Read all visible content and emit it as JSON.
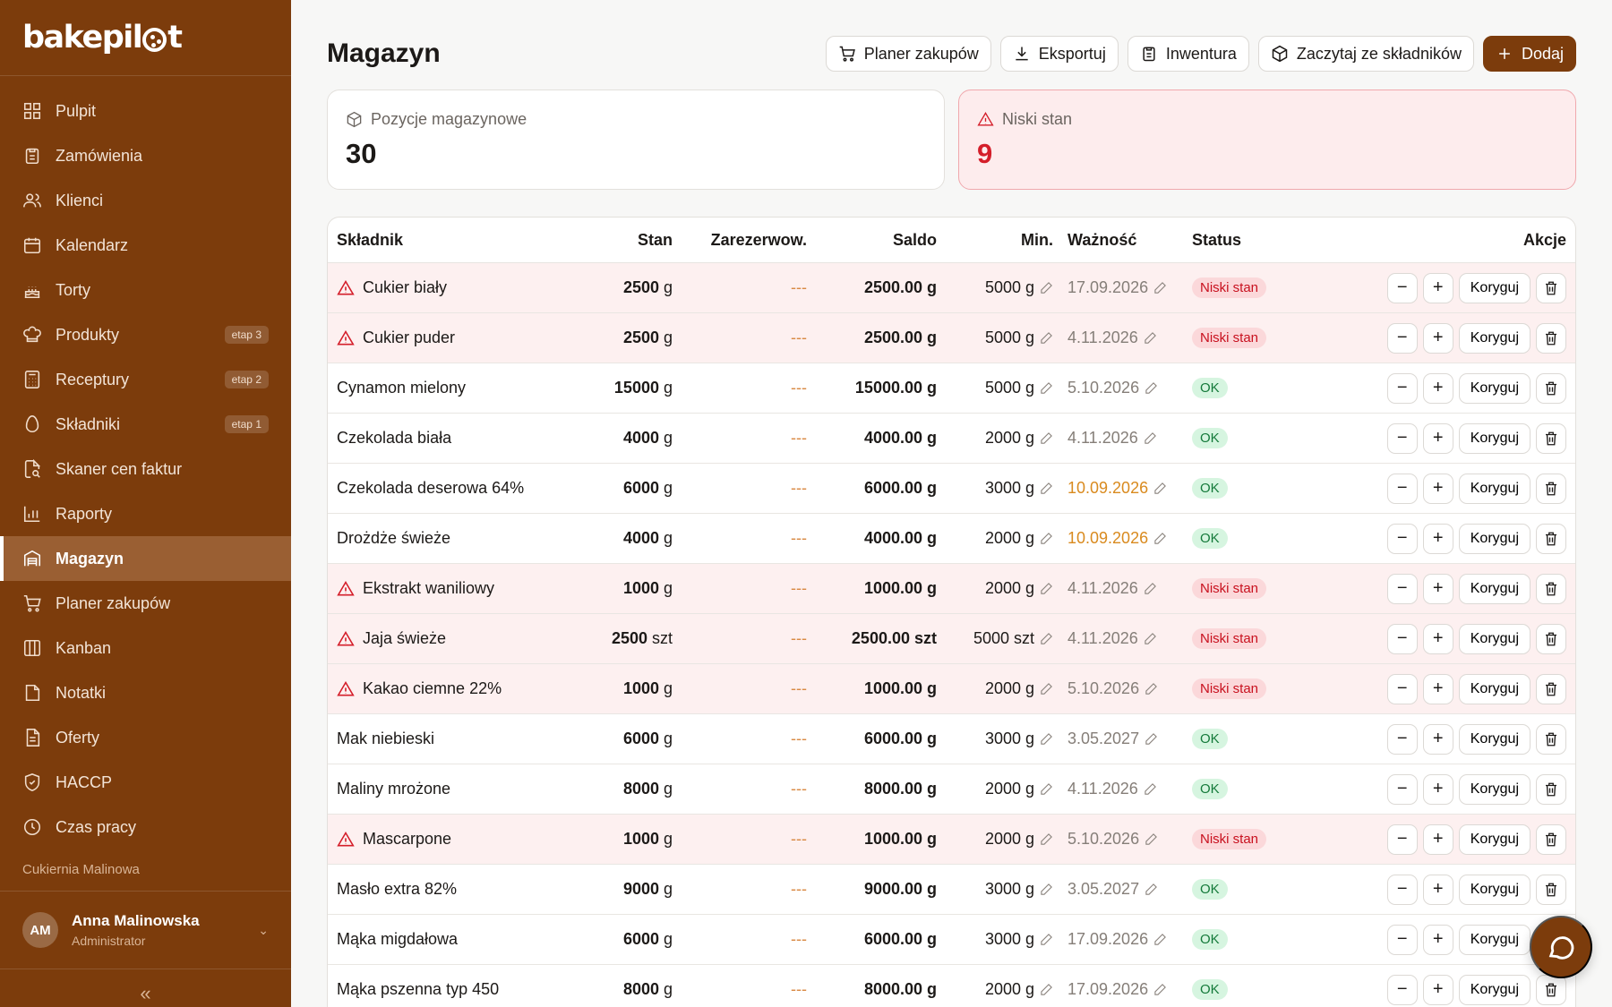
{
  "app": {
    "logo_text_a": "bakepil",
    "logo_text_b": "t"
  },
  "sidebar": {
    "items": [
      {
        "label": "Pulpit",
        "icon": "dashboard-icon",
        "badge": ""
      },
      {
        "label": "Zamówienia",
        "icon": "clipboard-icon",
        "badge": ""
      },
      {
        "label": "Klienci",
        "icon": "users-icon",
        "badge": ""
      },
      {
        "label": "Kalendarz",
        "icon": "calendar-icon",
        "badge": ""
      },
      {
        "label": "Torty",
        "icon": "cake-icon",
        "badge": ""
      },
      {
        "label": "Produkty",
        "icon": "chef-hat-icon",
        "badge": "etap 3"
      },
      {
        "label": "Receptury",
        "icon": "calculator-icon",
        "badge": "etap 2"
      },
      {
        "label": "Składniki",
        "icon": "egg-icon",
        "badge": "etap 1"
      },
      {
        "label": "Skaner cen faktur",
        "icon": "file-scan-icon",
        "badge": ""
      },
      {
        "label": "Raporty",
        "icon": "bar-chart-icon",
        "badge": ""
      },
      {
        "label": "Magazyn",
        "icon": "warehouse-icon",
        "badge": ""
      },
      {
        "label": "Planer zakupów",
        "icon": "cart-icon",
        "badge": ""
      },
      {
        "label": "Kanban",
        "icon": "kanban-icon",
        "badge": ""
      },
      {
        "label": "Notatki",
        "icon": "note-icon",
        "badge": ""
      },
      {
        "label": "Oferty",
        "icon": "document-icon",
        "badge": ""
      },
      {
        "label": "HACCP",
        "icon": "shield-icon",
        "badge": ""
      },
      {
        "label": "Czas pracy",
        "icon": "clock-icon",
        "badge": ""
      }
    ],
    "active_index": 10,
    "org_name": "Cukiernia Malinowa",
    "user": {
      "initials": "AM",
      "name": "Anna Malinowska",
      "role": "Administrator"
    },
    "collapse_label": "«"
  },
  "header": {
    "title": "Magazyn",
    "buttons": {
      "planner": "Planer zakupów",
      "export": "Eksportuj",
      "inventory": "Inwentura",
      "read_ingredients": "Zaczytaj ze składników",
      "add": "Dodaj"
    }
  },
  "cards": {
    "positions": {
      "label": "Pozycje magazynowe",
      "value": "30"
    },
    "low_stock": {
      "label": "Niski stan",
      "value": "9"
    }
  },
  "table": {
    "headers": {
      "name": "Składnik",
      "stan": "Stan",
      "reserved": "Zarezerwow.",
      "saldo": "Saldo",
      "min": "Min.",
      "expiry": "Ważność",
      "status": "Status",
      "actions": "Akcje"
    },
    "adjust_label": "Koryguj",
    "rows": [
      {
        "name": "Cukier biały",
        "low": true,
        "stan_val": "2500",
        "unit": "g",
        "reserved": "---",
        "saldo": "2500.00 g",
        "min": "5000 g",
        "expiry": "17.09.2026",
        "soon": false,
        "status": "Niski stan"
      },
      {
        "name": "Cukier puder",
        "low": true,
        "stan_val": "2500",
        "unit": "g",
        "reserved": "---",
        "saldo": "2500.00 g",
        "min": "5000 g",
        "expiry": "4.11.2026",
        "soon": false,
        "status": "Niski stan"
      },
      {
        "name": "Cynamon mielony",
        "low": false,
        "stan_val": "15000",
        "unit": "g",
        "reserved": "---",
        "saldo": "15000.00 g",
        "min": "5000 g",
        "expiry": "5.10.2026",
        "soon": false,
        "status": "OK"
      },
      {
        "name": "Czekolada biała",
        "low": false,
        "stan_val": "4000",
        "unit": "g",
        "reserved": "---",
        "saldo": "4000.00 g",
        "min": "2000 g",
        "expiry": "4.11.2026",
        "soon": false,
        "status": "OK"
      },
      {
        "name": "Czekolada deserowa 64%",
        "low": false,
        "stan_val": "6000",
        "unit": "g",
        "reserved": "---",
        "saldo": "6000.00 g",
        "min": "3000 g",
        "expiry": "10.09.2026",
        "soon": true,
        "status": "OK"
      },
      {
        "name": "Drożdże świeże",
        "low": false,
        "stan_val": "4000",
        "unit": "g",
        "reserved": "---",
        "saldo": "4000.00 g",
        "min": "2000 g",
        "expiry": "10.09.2026",
        "soon": true,
        "status": "OK"
      },
      {
        "name": "Ekstrakt waniliowy",
        "low": true,
        "stan_val": "1000",
        "unit": "g",
        "reserved": "---",
        "saldo": "1000.00 g",
        "min": "2000 g",
        "expiry": "4.11.2026",
        "soon": false,
        "status": "Niski stan"
      },
      {
        "name": "Jaja świeże",
        "low": true,
        "stan_val": "2500",
        "unit": "szt",
        "reserved": "---",
        "saldo": "2500.00 szt",
        "min": "5000 szt",
        "expiry": "4.11.2026",
        "soon": false,
        "status": "Niski stan"
      },
      {
        "name": "Kakao ciemne 22%",
        "low": true,
        "stan_val": "1000",
        "unit": "g",
        "reserved": "---",
        "saldo": "1000.00 g",
        "min": "2000 g",
        "expiry": "5.10.2026",
        "soon": false,
        "status": "Niski stan"
      },
      {
        "name": "Mak niebieski",
        "low": false,
        "stan_val": "6000",
        "unit": "g",
        "reserved": "---",
        "saldo": "6000.00 g",
        "min": "3000 g",
        "expiry": "3.05.2027",
        "soon": false,
        "status": "OK"
      },
      {
        "name": "Maliny mrożone",
        "low": false,
        "stan_val": "8000",
        "unit": "g",
        "reserved": "---",
        "saldo": "8000.00 g",
        "min": "2000 g",
        "expiry": "4.11.2026",
        "soon": false,
        "status": "OK"
      },
      {
        "name": "Mascarpone",
        "low": true,
        "stan_val": "1000",
        "unit": "g",
        "reserved": "---",
        "saldo": "1000.00 g",
        "min": "2000 g",
        "expiry": "5.10.2026",
        "soon": false,
        "status": "Niski stan"
      },
      {
        "name": "Masło extra 82%",
        "low": false,
        "stan_val": "9000",
        "unit": "g",
        "reserved": "---",
        "saldo": "9000.00 g",
        "min": "3000 g",
        "expiry": "3.05.2027",
        "soon": false,
        "status": "OK"
      },
      {
        "name": "Mąka migdałowa",
        "low": false,
        "stan_val": "6000",
        "unit": "g",
        "reserved": "---",
        "saldo": "6000.00 g",
        "min": "3000 g",
        "expiry": "17.09.2026",
        "soon": false,
        "status": "OK"
      },
      {
        "name": "Mąka pszenna typ 450",
        "low": false,
        "stan_val": "8000",
        "unit": "g",
        "reserved": "---",
        "saldo": "8000.00 g",
        "min": "2000 g",
        "expiry": "17.09.2026",
        "soon": false,
        "status": "OK"
      }
    ]
  },
  "colors": {
    "brand": "#7c3c0c",
    "danger": "#d41e2a",
    "ok": "#147a3a",
    "warning": "#d98a1e"
  }
}
